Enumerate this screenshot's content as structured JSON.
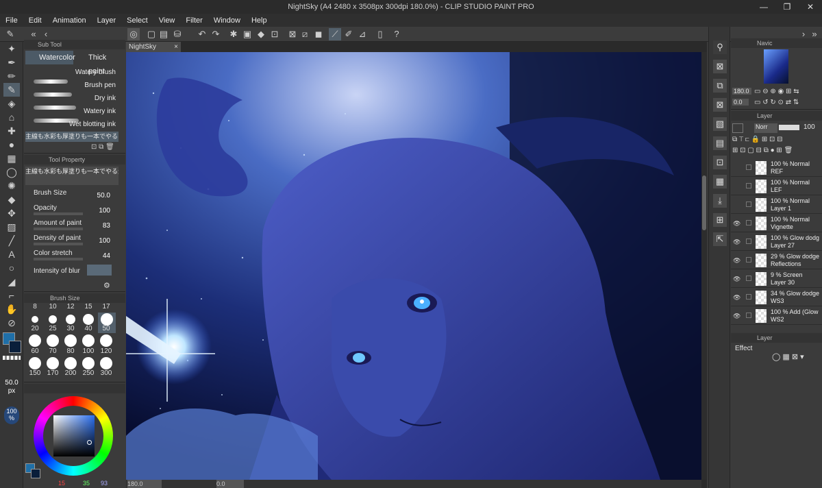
{
  "window": {
    "title": "NightSky (A4 2480 x 3508px 300dpi 180.0%)  - CLIP STUDIO PAINT PRO",
    "controls": [
      "—",
      "❐",
      "✕"
    ]
  },
  "menu": [
    "File",
    "Edit",
    "Animation",
    "Layer",
    "Select",
    "View",
    "Filter",
    "Window",
    "Help"
  ],
  "canvas": {
    "tab_label": "NightSky",
    "zoom": "180.0",
    "rotation": "0.0"
  },
  "sub_tool": {
    "header": "Sub Tool",
    "tabs": [
      "Watercolor",
      "Thick paint"
    ],
    "brushes": [
      "Watery brush",
      "Brush pen",
      "Dry ink",
      "Watery ink",
      "Wet blotting ink"
    ],
    "selected_brush": "主線も水彩も厚塗りも一本でやる"
  },
  "tool_property": {
    "header": "Tool Property",
    "brush_name": "主線も水彩も厚塗りも一本でやる生ポンのブラシ",
    "props": [
      {
        "label": "Brush Size",
        "value": "50.0"
      },
      {
        "label": "Opacity",
        "value": "100"
      },
      {
        "label": "Amount of paint",
        "value": "83"
      },
      {
        "label": "Density of paint",
        "value": "100"
      },
      {
        "label": "Color stretch",
        "value": "44"
      },
      {
        "label": "Intensity of blur",
        "value": ""
      }
    ]
  },
  "brush_size": {
    "header": "Brush Size",
    "top_row": [
      "8",
      "10",
      "12",
      "15",
      "17"
    ],
    "row1": [
      "20",
      "25",
      "30",
      "40",
      "50"
    ],
    "row2": [
      "60",
      "70",
      "80",
      "100",
      "120"
    ],
    "row3": [
      "150",
      "170",
      "200",
      "250",
      "300"
    ],
    "selected": "50"
  },
  "toolbox": {
    "brush_size_readout": "50.0",
    "brush_size_unit": "px",
    "opacity_readout": "100",
    "opacity_unit": "%"
  },
  "color": {
    "main": "#1f6fa8",
    "sub": "#0a1e3a",
    "r": "15",
    "g": "35",
    "b": "93"
  },
  "navigator": {
    "header": "Navic",
    "zoom": "180.0",
    "rotation": "0.0"
  },
  "layer_panel": {
    "header": "Layer",
    "blend_mode": "Norr",
    "opacity": "100",
    "layers": [
      {
        "mode": "100 % Normal",
        "name": "REF",
        "visible": false
      },
      {
        "mode": "100 % Normal",
        "name": "LEF",
        "visible": false
      },
      {
        "mode": "100 % Normal",
        "name": "Layer 1",
        "visible": false
      },
      {
        "mode": "100 % Normal",
        "name": "Vignette",
        "visible": true
      },
      {
        "mode": "100 % Glow dodg",
        "name": "Layer 27",
        "visible": true
      },
      {
        "mode": "29 % Glow dodge",
        "name": "Reflections",
        "visible": true
      },
      {
        "mode": "9 % Screen",
        "name": "Layer 30",
        "visible": true
      },
      {
        "mode": "34 % Glow dodge",
        "name": "WS3",
        "visible": true
      },
      {
        "mode": "100 % Add (Glow",
        "name": "WS2",
        "visible": true
      }
    ]
  },
  "effect_panel": {
    "header": "Effect"
  }
}
